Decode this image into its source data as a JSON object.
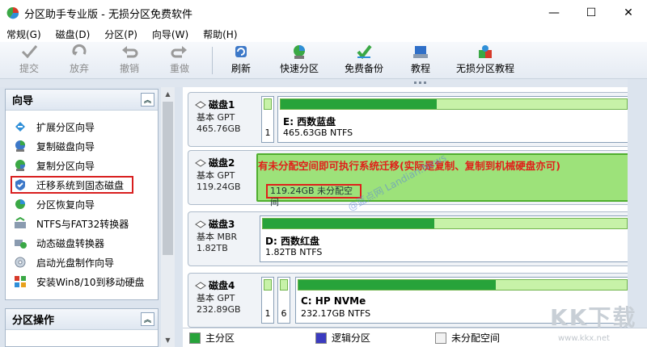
{
  "window": {
    "title": "分区助手专业版 - 无损分区免费软件",
    "minimize": "—",
    "maximize": "☐",
    "close": "✕"
  },
  "menu": [
    "常规(G)",
    "磁盘(D)",
    "分区(P)",
    "向导(W)",
    "帮助(H)"
  ],
  "toolbar": [
    {
      "label": "提交",
      "icon": "check-icon",
      "enabled": false
    },
    {
      "label": "放弃",
      "icon": "discard-icon",
      "enabled": false
    },
    {
      "label": "撤销",
      "icon": "undo-icon",
      "enabled": false
    },
    {
      "label": "重做",
      "icon": "redo-icon",
      "enabled": false
    },
    {
      "label": "刷新",
      "icon": "refresh-icon",
      "enabled": true
    },
    {
      "label": "快速分区",
      "icon": "quick-partition-icon",
      "enabled": true
    },
    {
      "label": "免费备份",
      "icon": "backup-icon",
      "enabled": true
    },
    {
      "label": "教程",
      "icon": "tutorial-icon",
      "enabled": true
    },
    {
      "label": "无损分区教程",
      "icon": "lossless-tutorial-icon",
      "enabled": true
    }
  ],
  "wizard_panel": {
    "title": "向导",
    "items": [
      "扩展分区向导",
      "复制磁盘向导",
      "复制分区向导",
      "迁移系统到固态磁盘",
      "分区恢复向导",
      "NTFS与FAT32转换器",
      "动态磁盘转换器",
      "启动光盘制作向导",
      "安装Win8/10到移动硬盘"
    ]
  },
  "partition_panel": {
    "title": "分区操作"
  },
  "disks": [
    {
      "name": "磁盘1",
      "type": "基本 GPT",
      "size": "465.76GB",
      "parts": [
        {
          "num": "1"
        },
        {
          "label": "E: 西数蓝盘",
          "size": "465.63GB NTFS",
          "used": 0.45
        }
      ]
    },
    {
      "name": "磁盘2",
      "type": "基本 GPT",
      "size": "119.24GB",
      "unallocated": "119.24GB 未分配空间",
      "annotation": "有未分配空间即可执行系统迁移(实际是复制、复制到机械硬盘亦可)"
    },
    {
      "name": "磁盘3",
      "type": "基本 MBR",
      "size": "1.82TB",
      "parts": [
        {
          "label": "D: 西数红盘",
          "size": "1.82TB NTFS",
          "used": 0.47
        }
      ]
    },
    {
      "name": "磁盘4",
      "type": "基本 GPT",
      "size": "232.89GB",
      "parts": [
        {
          "num": "1"
        },
        {
          "num": "6"
        },
        {
          "label": "C: HP NVMe",
          "size": "232.17GB NTFS",
          "used": 0.6
        }
      ]
    }
  ],
  "watermark": "@蓝点网 Landian.News",
  "legend": [
    {
      "label": "主分区",
      "color": "#27a33a"
    },
    {
      "label": "逻辑分区",
      "color": "#3b3bbf"
    },
    {
      "label": "未分配空间",
      "color": "#f2f2f2"
    }
  ],
  "brand_logo": "KK下载",
  "brand_url": "www.kkx.net"
}
